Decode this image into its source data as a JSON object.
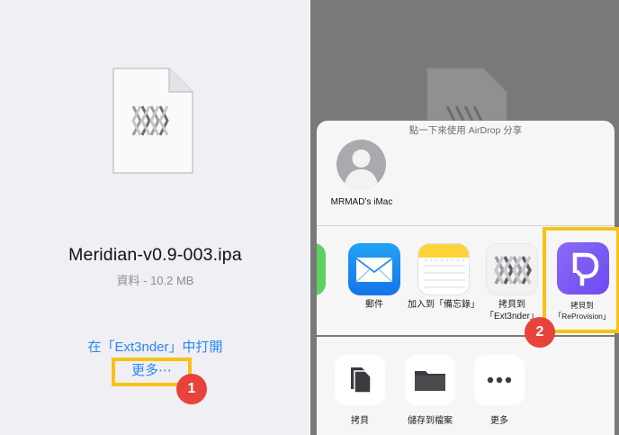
{
  "left": {
    "file_name": "Meridian-v0.9-003.ipa",
    "file_meta": "資料 - 10.2 MB",
    "open_in": "在「Ext3nder」中打開",
    "more": "更多⋯",
    "step1": "1"
  },
  "share_sheet": {
    "airdrop_title": "點一下來使用 AirDrop 分享",
    "airdrop_device": "MRMAD’s iMac",
    "apps": [
      {
        "label": "郵件",
        "icon": "mail-icon"
      },
      {
        "label": "加入到「備忘錄」",
        "icon": "notes-icon"
      },
      {
        "label": "拷貝到「Ext3nder」",
        "icon": "ext3nder-icon"
      },
      {
        "label": "拷貝到「ReProvision」",
        "icon": "reprovision-icon"
      }
    ],
    "actions": [
      {
        "label": "拷貝",
        "icon": "copy-icon"
      },
      {
        "label": "儲存到檔案",
        "icon": "folder-icon"
      },
      {
        "label": "更多",
        "icon": "more-dots-icon"
      }
    ],
    "step2": "2"
  },
  "colors": {
    "accent": "#2a86f4",
    "highlight": "#f8c215",
    "badge": "#e8433a",
    "reprovision": "#7a58f3"
  }
}
